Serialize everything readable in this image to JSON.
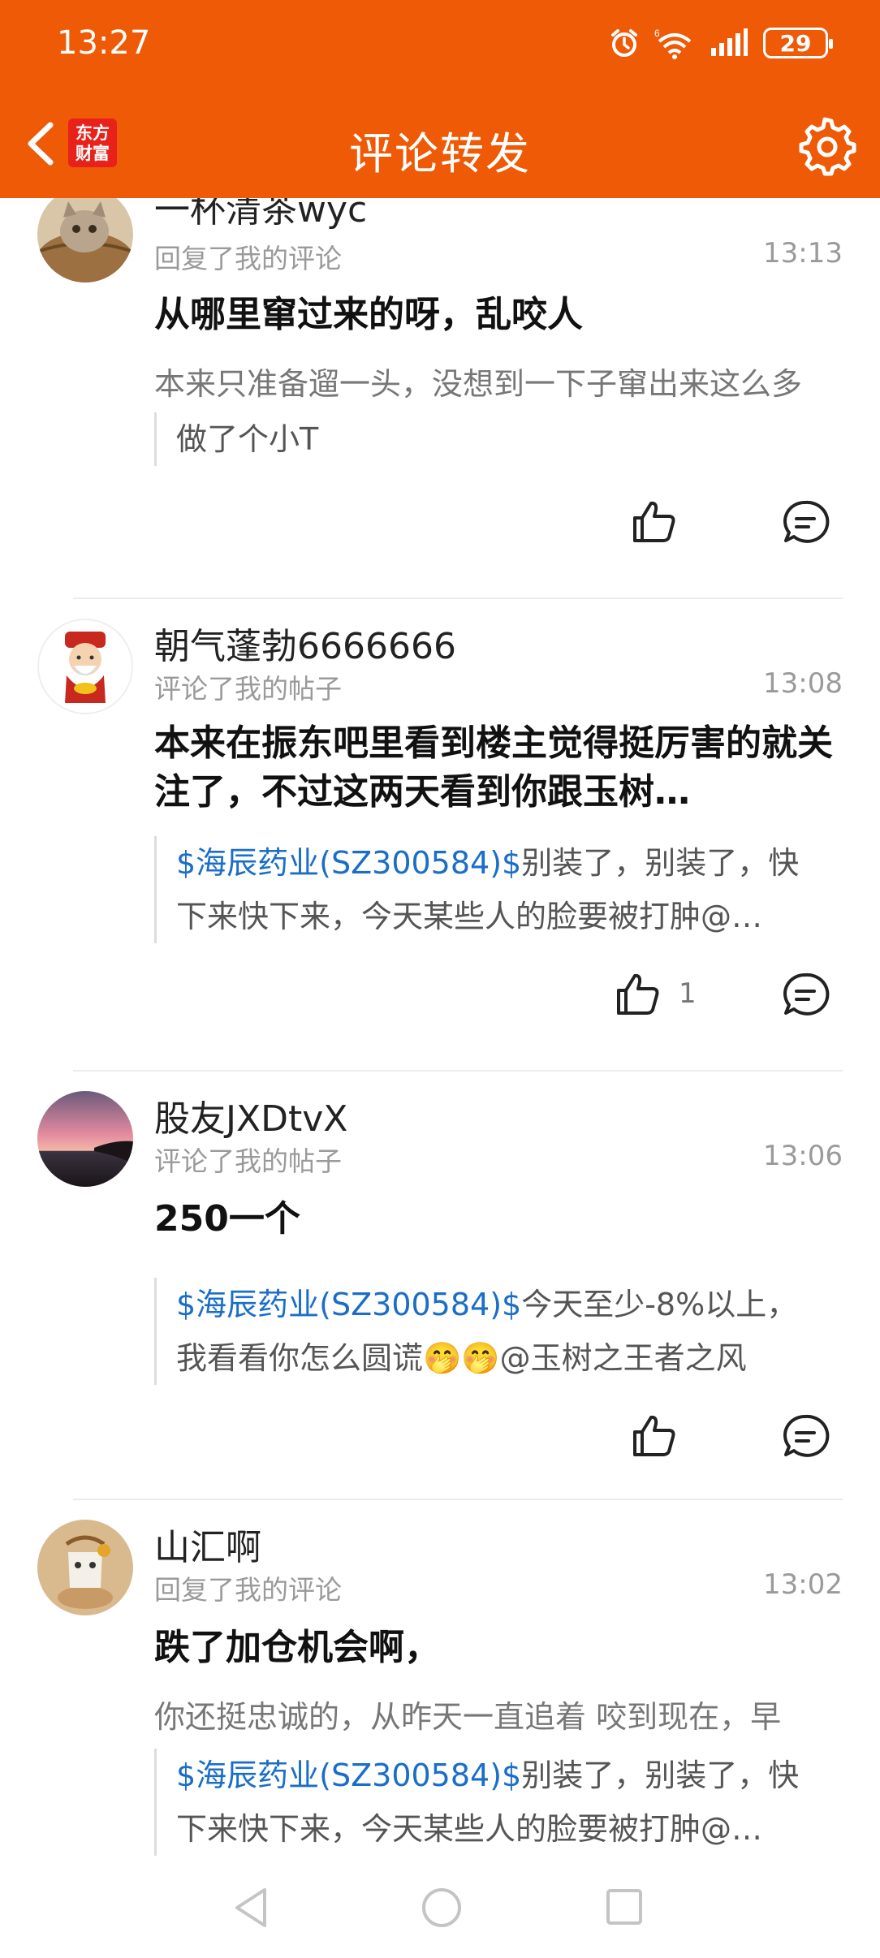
{
  "status_bar": {
    "time": "13:27",
    "battery": "29"
  },
  "header": {
    "title": "评论转发",
    "logo_text": "东方财富"
  },
  "items": [
    {
      "username": "一杯清茶wyc",
      "action": "回复了我的评论",
      "time": "13:13",
      "content": "从哪里窜过来的呀，乱咬人",
      "excerpt": "本来只准备遛一头，没想到一下子窜出来这么多",
      "quote": "做了个小T",
      "likes": ""
    },
    {
      "username": "朝气蓬勃6666666",
      "action": "评论了我的帖子",
      "time": "13:08",
      "content": "本来在振东吧里看到楼主觉得挺厉害的就关注了，不过这两天看到你跟玉树…",
      "quote_stock": "$海辰药业(SZ300584)$",
      "quote_line1": "别装了，别装了，快",
      "quote_line2": "下来快下来，今天某些人的脸要被打肿@…",
      "likes": "1"
    },
    {
      "username": "股友JXDtvX",
      "action": "评论了我的帖子",
      "time": "13:06",
      "content": "250一个",
      "quote_stock": "$海辰药业(SZ300584)$",
      "quote_line1": "今天至少-8%以上，",
      "quote_line2": "我看看你怎么圆谎🤭🤭@玉树之王者之风",
      "likes": ""
    },
    {
      "username": "山汇啊",
      "action": "回复了我的评论",
      "time": "13:02",
      "content": "跌了加仓机会啊，",
      "excerpt": "你还挺忠诚的，从昨天一直追着 咬到现在，早",
      "quote_stock": "$海辰药业(SZ300584)$",
      "quote_line1": "别装了，别装了，快",
      "quote_line2": "下来快下来，今天某些人的脸要被打肿@…",
      "likes": ""
    }
  ],
  "colors": {
    "brand": "#ee5a06",
    "stock_link": "#1a6ec8"
  }
}
